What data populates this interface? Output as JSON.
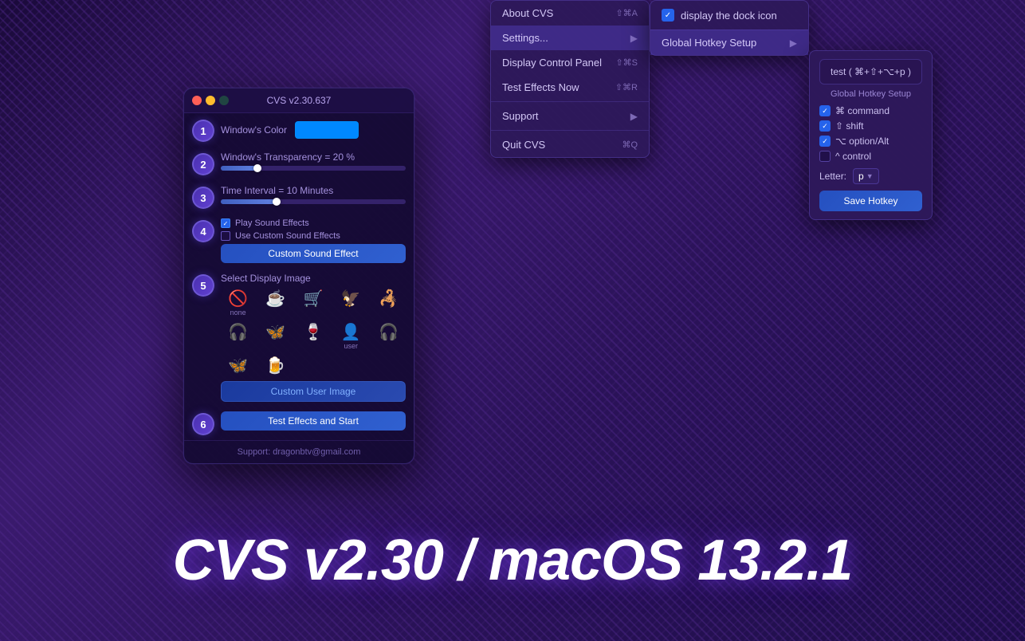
{
  "background": {
    "color": "#2a1a4e"
  },
  "bottom_title": {
    "text": "CVS v2.30  /  macOS 13.2.1"
  },
  "app_window": {
    "title": "CVS v2.30.637",
    "traffic_lights": [
      "red",
      "yellow",
      "green"
    ],
    "steps": [
      {
        "number": "1",
        "label": "Window's Color",
        "color_swatch": "#0088ff"
      },
      {
        "number": "2",
        "label": "Window's Transparency = 20 %",
        "slider_pct": 20
      },
      {
        "number": "3",
        "label": "Time Interval = 10 Minutes",
        "slider_pct": 30
      },
      {
        "number": "4",
        "label": "",
        "checkboxes": [
          {
            "label": "Play Sound Effects",
            "checked": true
          },
          {
            "label": "Use Custom Sound Effects",
            "checked": false
          }
        ],
        "button": "Custom Sound Effect"
      },
      {
        "number": "5",
        "label": "Select Display Image",
        "images": [
          {
            "icon": "🚫",
            "label": "none"
          },
          {
            "icon": "☕",
            "label": ""
          },
          {
            "icon": "🛒",
            "label": ""
          },
          {
            "icon": "🦅",
            "label": ""
          },
          {
            "icon": "🦂",
            "label": ""
          },
          {
            "icon": "🎧",
            "label": ""
          },
          {
            "icon": "🦋",
            "label": ""
          },
          {
            "icon": "🍷",
            "label": ""
          },
          {
            "icon": "👤",
            "label": "user"
          },
          {
            "icon": "🎧",
            "label": ""
          },
          {
            "icon": "🦋",
            "label": ""
          },
          {
            "icon": "🍺",
            "label": ""
          }
        ],
        "custom_button": "Custom User Image"
      },
      {
        "number": "6",
        "button": "Test Effects and Start"
      }
    ],
    "support": "Support:  dragonbtv@gmail.com"
  },
  "menu": {
    "items": [
      {
        "label": "About CVS",
        "shortcut": "⇧⌘A",
        "arrow": false,
        "active": false
      },
      {
        "label": "Settings...",
        "shortcut": "",
        "arrow": true,
        "active": true
      },
      {
        "label": "Display Control Panel",
        "shortcut": "⇧⌘S",
        "arrow": false,
        "active": false
      },
      {
        "label": "Test Effects Now",
        "shortcut": "⇧⌘R",
        "arrow": false,
        "active": false
      },
      {
        "separator": true
      },
      {
        "label": "Support",
        "shortcut": "",
        "arrow": true,
        "active": false
      },
      {
        "separator": true
      },
      {
        "label": "Quit CVS",
        "shortcut": "⌘Q",
        "arrow": false,
        "active": false
      }
    ]
  },
  "submenu_settings": {
    "items": [
      {
        "label": "display the dock icon",
        "checked": true
      }
    ],
    "submenu_item": {
      "label": "Global Hotkey Setup",
      "arrow": true
    }
  },
  "submenu_hotkey": {
    "test_item": "test ( ⌘+⇧+⌥+p )",
    "title": "Global Hotkey Setup",
    "checkboxes": [
      {
        "label": "⌘ command",
        "checked": true
      },
      {
        "label": "⇧ shift",
        "checked": true
      },
      {
        "label": "⌥ option/Alt",
        "checked": true
      },
      {
        "label": "^ control",
        "checked": false
      }
    ],
    "letter_label": "Letter:",
    "letter_value": "p",
    "save_button": "Save Hotkey"
  }
}
